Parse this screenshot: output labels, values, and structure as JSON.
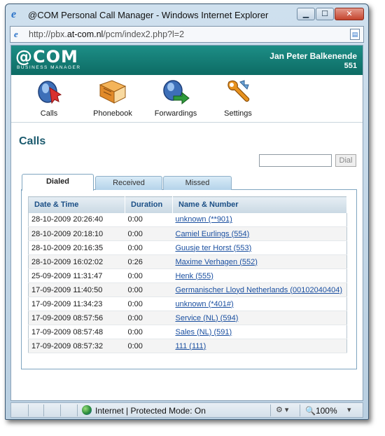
{
  "window": {
    "title": "@COM Personal Call Manager - Windows Internet Explorer",
    "address": {
      "scheme": "http://pbx.",
      "host": "at-com.nl",
      "path": "/pcm/index2.php?l=2"
    }
  },
  "header": {
    "brand": "@COM",
    "brand_sub": "BUSINESS MANAGER",
    "user_name": "Jan Peter Balkenende",
    "user_ext": "551"
  },
  "toolbar": {
    "items": [
      {
        "label": "Calls",
        "icon": "calls-icon"
      },
      {
        "label": "Phonebook",
        "icon": "phonebook-icon"
      },
      {
        "label": "Forwardings",
        "icon": "forwardings-icon"
      },
      {
        "label": "Settings",
        "icon": "settings-icon"
      }
    ]
  },
  "page": {
    "title": "Calls",
    "dial_value": "",
    "dial_button": "Dial"
  },
  "tabs": [
    {
      "label": "Dialed",
      "active": true
    },
    {
      "label": "Received",
      "active": false
    },
    {
      "label": "Missed",
      "active": false
    }
  ],
  "table": {
    "columns": [
      "Date & Time",
      "Duration",
      "Name & Number"
    ],
    "rows": [
      {
        "datetime": "28-10-2009 20:26:40",
        "duration": "0:00",
        "name": "unknown (**901)"
      },
      {
        "datetime": "28-10-2009 20:18:10",
        "duration": "0:00",
        "name": "Camiel Eurlings (554)"
      },
      {
        "datetime": "28-10-2009 20:16:35",
        "duration": "0:00",
        "name": "Guusje ter Horst (553)"
      },
      {
        "datetime": "28-10-2009 16:02:02",
        "duration": "0:26",
        "name": "Maxime Verhagen (552)"
      },
      {
        "datetime": "25-09-2009 11:31:47",
        "duration": "0:00",
        "name": "Henk (555)"
      },
      {
        "datetime": "17-09-2009 11:40:50",
        "duration": "0:00",
        "name": "Germanischer Lloyd Netherlands (00102040404)"
      },
      {
        "datetime": "17-09-2009 11:34:23",
        "duration": "0:00",
        "name": "unknown (*401#)"
      },
      {
        "datetime": "17-09-2009 08:57:56",
        "duration": "0:00",
        "name": "Service (NL) (594)"
      },
      {
        "datetime": "17-09-2009 08:57:48",
        "duration": "0:00",
        "name": "Sales (NL) (591)"
      },
      {
        "datetime": "17-09-2009 08:57:32",
        "duration": "0:00",
        "name": "111 (111)"
      }
    ]
  },
  "statusbar": {
    "zone_text": "Internet | Protected Mode: On",
    "zoom": "100%"
  },
  "colors": {
    "header_teal": "#0d6b64",
    "link_blue": "#1a4fa0",
    "title_teal": "#1b5a6e"
  }
}
